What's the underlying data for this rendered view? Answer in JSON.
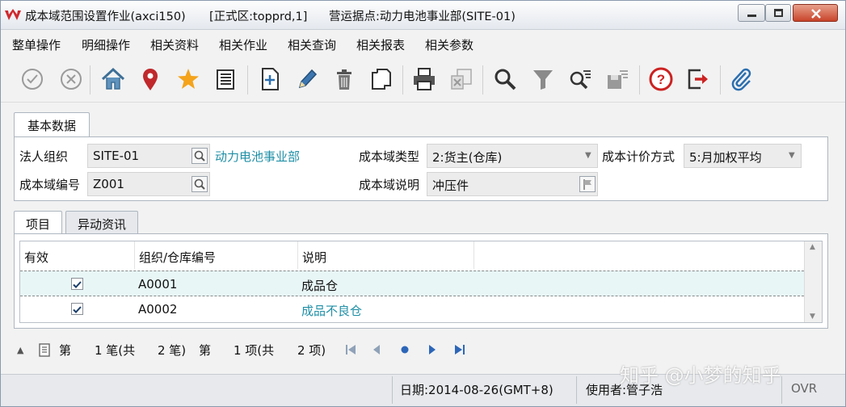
{
  "window": {
    "title": "成本域范围设置作业(axci150)",
    "env": "[正式区:topprd,1]",
    "site": "营运据点:动力电池事业部(SITE-01)"
  },
  "menu": [
    "整单操作",
    "明细操作",
    "相关资料",
    "相关作业",
    "相关查询",
    "相关报表",
    "相关参数"
  ],
  "tabs_top": {
    "basic": "基本数据"
  },
  "form": {
    "legal_org_label": "法人组织",
    "legal_org_value": "SITE-01",
    "legal_org_name": "动力电池事业部",
    "domain_type_label": "成本域类型",
    "domain_type_value": "2:货主(仓库)",
    "cost_method_label": "成本计价方式",
    "cost_method_value": "5:月加权平均",
    "domain_no_label": "成本域编号",
    "domain_no_value": "Z001",
    "domain_desc_label": "成本域说明",
    "domain_desc_value": "冲压件"
  },
  "tabs_bottom": {
    "items": "项目",
    "changes": "异动资讯"
  },
  "grid": {
    "headers": [
      "有效",
      "组织/仓库编号",
      "说明"
    ],
    "rows": [
      {
        "valid": true,
        "code": "A0001",
        "desc": "成品仓"
      },
      {
        "valid": true,
        "code": "A0002",
        "desc": "成品不良仓"
      }
    ]
  },
  "pager": {
    "prefix1": "第",
    "cur_record": "1 笔(共",
    "total_records": "2 笔)",
    "prefix2": "第",
    "cur_item": "1 项(共",
    "total_items": "2 项)"
  },
  "status": {
    "date": "日期:2014-08-26(GMT+8)",
    "user": "使用者:管子浩",
    "mode": "OVR"
  },
  "watermark": "知乎 @小梦的知乎",
  "colors": {
    "accent_link": "#1f8fa6",
    "selected_row": "#e8f6f6",
    "logo": "#d0282e"
  }
}
